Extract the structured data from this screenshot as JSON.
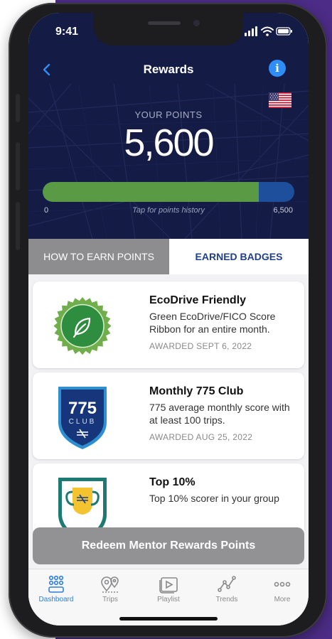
{
  "status": {
    "time": "9:41"
  },
  "nav": {
    "back_icon": "chevron-left-icon",
    "title": "Rewards",
    "info_icon": "info-icon",
    "info_glyph": "i"
  },
  "flag": "us-flag",
  "points": {
    "label": "YOUR POINTS",
    "value": "5,600",
    "min_label": "0",
    "max_label": "6,500",
    "hint": "Tap for points history",
    "progress_fraction": 0.86
  },
  "tabs": [
    {
      "label": "HOW TO EARN POINTS",
      "active": false
    },
    {
      "label": "EARNED BADGES",
      "active": true
    }
  ],
  "badges": [
    {
      "title": "EcoDrive Friendly",
      "description": "Green EcoDrive/FICO Score Ribbon for an entire month.",
      "awarded": "AWARDED SEPT 6, 2022",
      "icon": "leaf-badge-icon"
    },
    {
      "title": "Monthly 775 Club",
      "description": "775 average monthly score with at least 100 trips.",
      "awarded": "AWARDED AUG 25, 2022",
      "icon": "775-club-shield-icon",
      "badge_number": "775",
      "badge_word": "CLUB"
    },
    {
      "title": "Top 10%",
      "description": "Top 10% scorer in your group",
      "awarded": "",
      "icon": "trophy-badge-icon"
    }
  ],
  "redeem_label": "Redeem Mentor Rewards Points",
  "tabbar": [
    {
      "label": "Dashboard",
      "icon": "dashboard-icon",
      "active": true
    },
    {
      "label": "Trips",
      "icon": "trips-icon",
      "active": false
    },
    {
      "label": "Playlist",
      "icon": "playlist-icon",
      "active": false
    },
    {
      "label": "Trends",
      "icon": "trends-icon",
      "active": false
    },
    {
      "label": "More",
      "icon": "more-icon",
      "active": false
    }
  ],
  "colors": {
    "header": "#141b45",
    "accent": "#2f8df7",
    "progress_green": "#5b9a45",
    "progress_blue": "#1d4f9c",
    "tab_active_text": "#1d3f8c"
  }
}
